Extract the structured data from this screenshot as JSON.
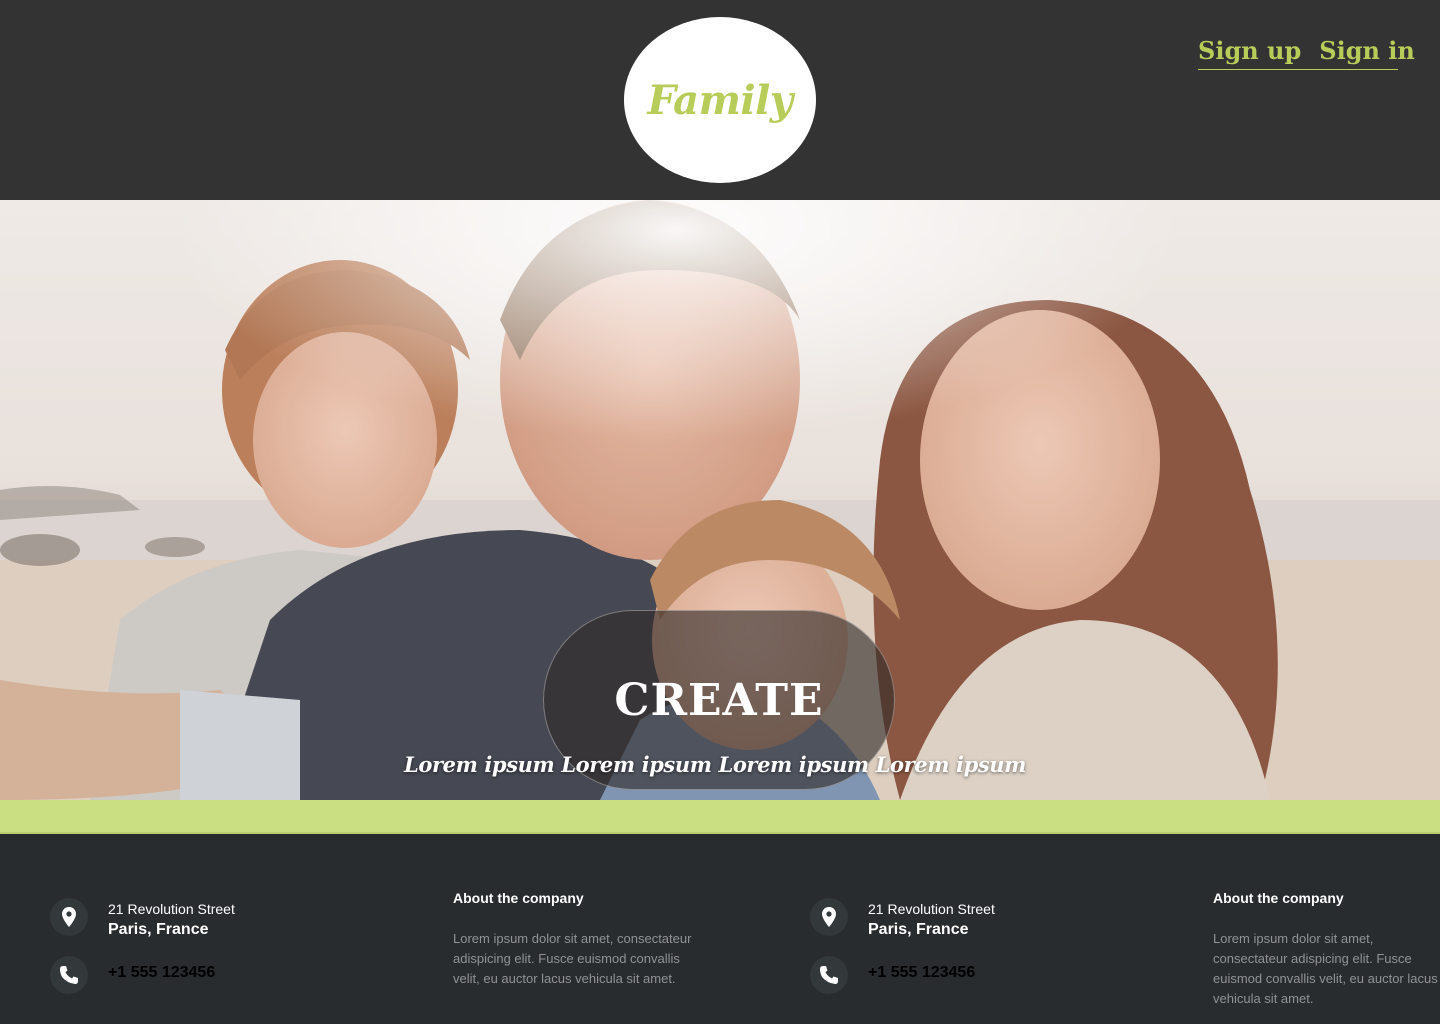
{
  "header": {
    "logo_text": "Family",
    "sign_up": "Sign up",
    "sign_in": "Sign in"
  },
  "hero": {
    "cta_label": "CREATE",
    "tagline": "Lorem ipsum Lorem ipsum Lorem ipsum Lorem ipsum"
  },
  "footer": {
    "columns": [
      {
        "street": "21 Revolution Street",
        "city": "Paris, France",
        "phone": "+1 555 123456"
      },
      {
        "about_title": "About the company",
        "about_text": "Lorem ipsum dolor sit amet, consectateur adispicing elit. Fusce euismod convallis velit, eu auctor lacus vehicula sit amet."
      },
      {
        "street": "21 Revolution Street",
        "city": "Paris, France",
        "phone": "+1 555 123456"
      },
      {
        "about_title": "About the company",
        "about_text": "Lorem ipsum dolor sit amet, consectateur adispicing elit. Fusce euismod convallis velit, eu auctor lacus vehicula sit amet."
      }
    ]
  },
  "icons": {
    "location": "map-pin-icon",
    "phone": "phone-icon"
  },
  "colors": {
    "header_bg": "#333333",
    "accent_green": "#b8cc5a",
    "band_green": "#c9df82",
    "footer_bg": "#292c2f"
  }
}
